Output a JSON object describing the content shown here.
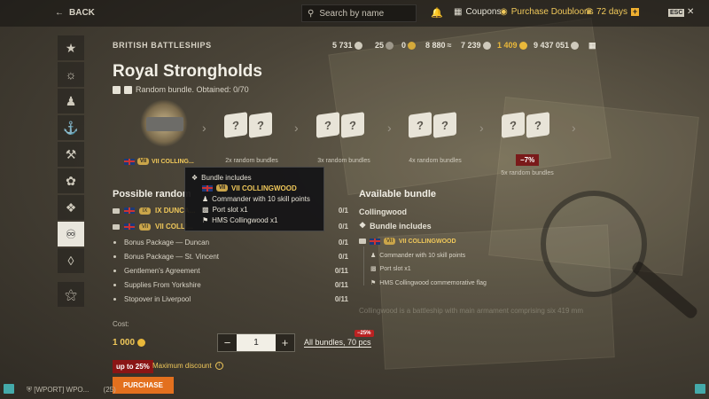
{
  "topbar": {
    "back_label": "BACK",
    "search_placeholder": "Search by name",
    "coupons_label": "Coupons",
    "purchase_doubloons_label": "Purchase Doubloons",
    "premium_days": "72 days",
    "esc_label": "ESC"
  },
  "sidebar": {
    "items": [
      "star-icon",
      "wings-icon",
      "commander-icon",
      "ship-icon",
      "tools-icon",
      "flags-icon",
      "tag-icon",
      "medal-icon",
      "camo-icon",
      "emblem-icon"
    ],
    "active_index": 7
  },
  "header": {
    "category": "BRITISH BATTLESHIPS",
    "title": "Royal Strongholds",
    "subtitle": "Random bundle. Obtained: 0/70"
  },
  "resources": [
    {
      "value": "5 731",
      "icon": "credits-icon",
      "color": "#cfcabc"
    },
    {
      "value": "25",
      "icon": "coal-icon",
      "color": "#9d978a"
    },
    {
      "value": "0",
      "icon": "steel-icon",
      "color": "#d4a93a"
    },
    {
      "value": "8 880",
      "icon": "free-xp-icon",
      "color": "#cfcabc"
    },
    {
      "value": "7 239",
      "icon": "research-icon",
      "color": "#cfcabc"
    },
    {
      "value": "1 409",
      "icon": "doubloons-icon",
      "color": "#e9b83a"
    },
    {
      "value": "9 437 051",
      "icon": "silver-icon",
      "color": "#cfcabc"
    }
  ],
  "bundle_track": {
    "ship_label": "VII COLLING...",
    "ship_tier": "VII",
    "options": [
      {
        "label": "2x random bundles",
        "discount": ""
      },
      {
        "label": "3x random bundles",
        "discount": ""
      },
      {
        "label": "4x random bundles",
        "discount": ""
      },
      {
        "label": "5x random bundles",
        "discount": "−7%"
      }
    ]
  },
  "possible_rewards": {
    "title": "Possible random",
    "items": [
      {
        "name": "IX DUNCA...",
        "count": "0/1",
        "type": "ship",
        "tier": "IX"
      },
      {
        "name": "VII COLLI...",
        "count": "0/1",
        "type": "ship",
        "tier": "VII"
      },
      {
        "name": "Bonus Package — Duncan",
        "count": "0/1",
        "type": "item"
      },
      {
        "name": "Bonus Package — St. Vincent",
        "count": "0/1",
        "type": "item"
      },
      {
        "name": "Gentlemen's Agreement",
        "count": "0/11",
        "type": "item"
      },
      {
        "name": "Supplies From Yorkshire",
        "count": "0/11",
        "type": "item"
      },
      {
        "name": "Stopover in Liverpool",
        "count": "0/11",
        "type": "item"
      }
    ]
  },
  "tooltip": {
    "title": "Bundle includes",
    "ship": "VII COLLINGWOOD",
    "commander": "Commander with 10 skill points",
    "port": "Port slot x1",
    "flag": "HMS Collingwood x1"
  },
  "available_bundle": {
    "title": "Available bundle",
    "name": "Collingwood",
    "includes_label": "Bundle includes",
    "ship": "VII COLLINGWOOD",
    "commander": "Commander with 10 skill points",
    "port": "Port slot x1",
    "flag": "HMS Collingwood commemorative flag",
    "description": "Collingwood is a battleship with main armament comprising six 419 mm"
  },
  "purchase": {
    "cost_label": "Cost:",
    "cost_value": "1 000",
    "quantity": "1",
    "all_bundles": "All bundles, 70 pcs",
    "all_bundles_discount": "−25%",
    "upto": "up to 25%",
    "max_discount": "Maximum discount",
    "button": "PURCHASE"
  },
  "footer": {
    "clan": "[WPORT] WPO...",
    "clan_count": "(25)"
  }
}
